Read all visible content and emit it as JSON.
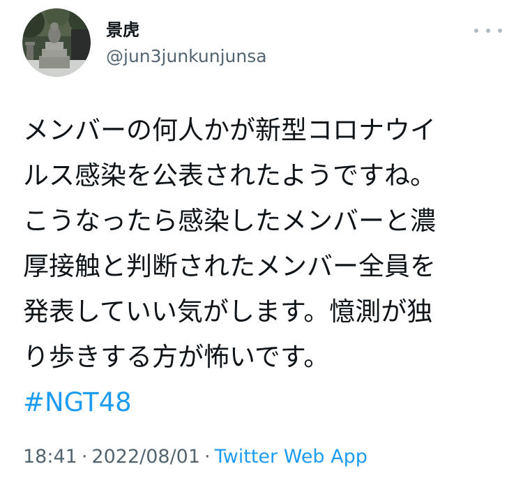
{
  "author": {
    "name": "景虎",
    "handle": "@jun3junkunjunsa"
  },
  "tweet": {
    "lines": [
      "メンバーの何人かが新型コロナウイ",
      "ルス感染を公表されたようですね。",
      "こうなったら感染したメンバーと濃",
      "厚接触と判断されたメンバー全員を",
      "発表していい気がします。憶測が独",
      "り歩きする方が怖いです。"
    ],
    "hashtag": "#NGT48"
  },
  "meta": {
    "time": "18:41",
    "separator1": "·",
    "date": "2022/08/01",
    "separator2": "·",
    "source": "Twitter Web App"
  },
  "icons": {
    "more": "more-horizontal-icon",
    "avatar": "avatar-photo"
  },
  "colors": {
    "text_primary": "#0f1419",
    "text_secondary": "#536471",
    "link": "#1d9bf0"
  }
}
